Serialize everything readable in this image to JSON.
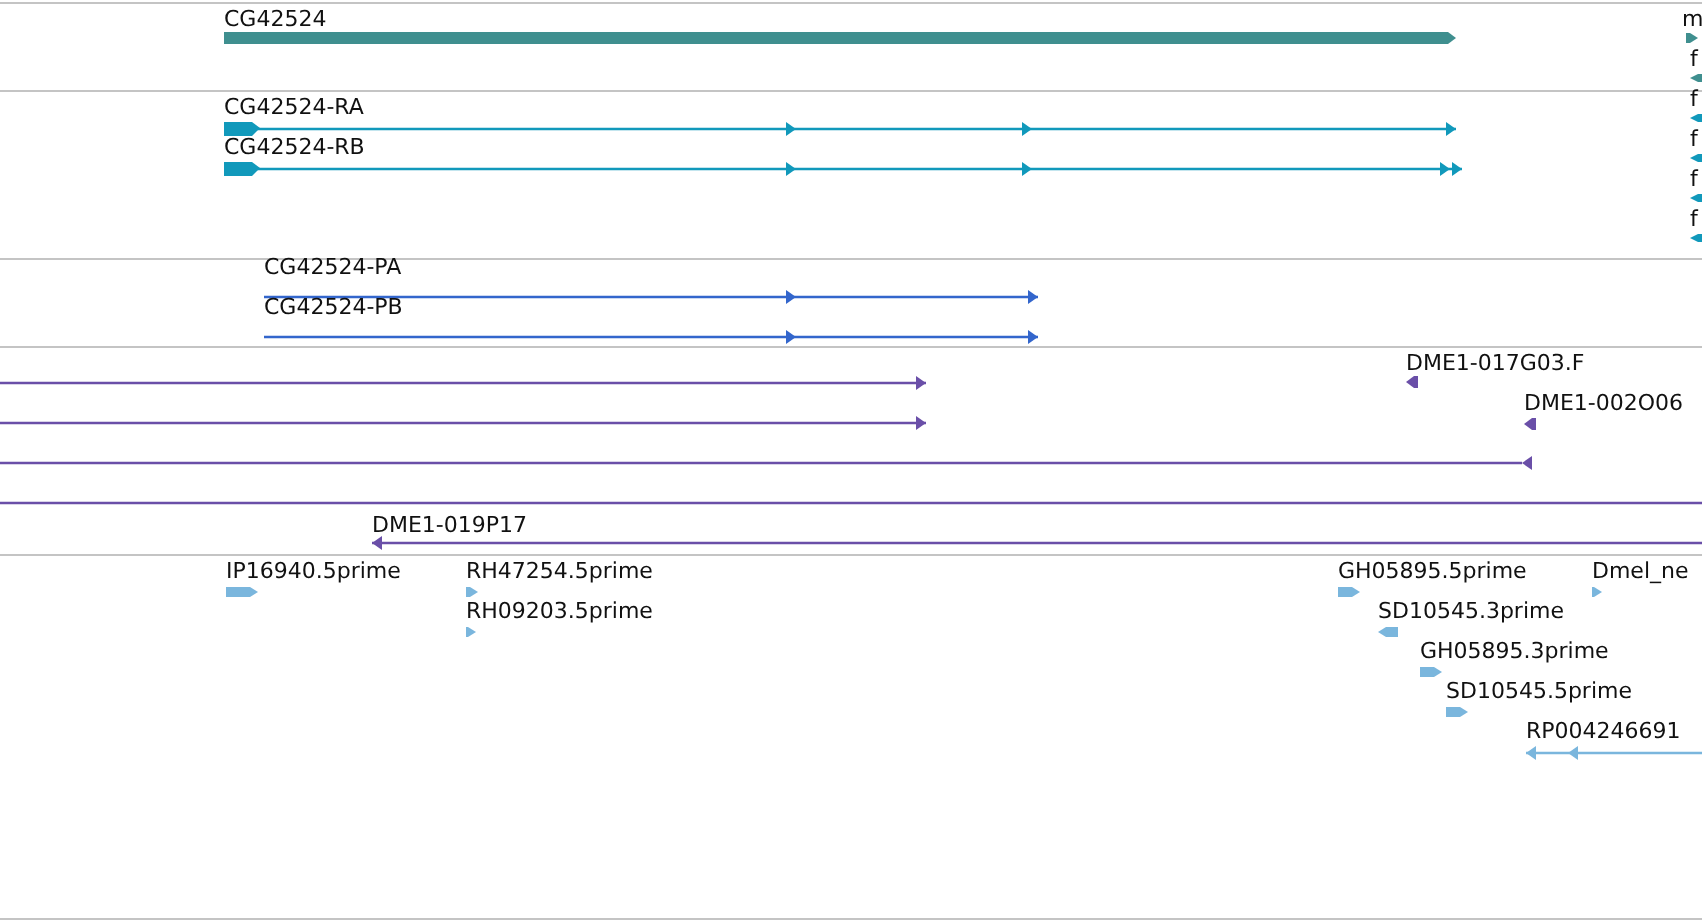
{
  "tracks": [
    {
      "kind": "gene",
      "features": [
        {
          "label": "CG42524",
          "reverse": false
        },
        {
          "label": "m",
          "reverse": false
        },
        {
          "label": "f",
          "reverse": true
        }
      ]
    },
    {
      "kind": "transcript",
      "features": [
        {
          "label": "CG42524-RA",
          "reverse": false
        },
        {
          "label": "CG42524-RB",
          "reverse": false
        },
        {
          "label": "f",
          "reverse": true
        },
        {
          "label": "f",
          "reverse": true
        },
        {
          "label": "f",
          "reverse": true
        },
        {
          "label": "f",
          "reverse": true
        }
      ]
    },
    {
      "kind": "protein",
      "features": [
        {
          "label": "CG42524-PA",
          "reverse": false
        },
        {
          "label": "CG42524-PB",
          "reverse": false
        }
      ]
    },
    {
      "kind": "clone",
      "features": [
        {
          "reverse": false
        },
        {
          "label": "DME1-017G03.F",
          "reverse": true
        },
        {
          "reverse": false
        },
        {
          "label": "DME1-002O06",
          "reverse": true
        },
        {
          "reverse": true
        },
        {
          "label": "DME1-019P17",
          "reverse": true
        }
      ]
    },
    {
      "kind": "est",
      "features": [
        {
          "label": "IP16940.5prime",
          "reverse": false
        },
        {
          "label": "RH47254.5prime",
          "reverse": false
        },
        {
          "label": "GH05895.5prime",
          "reverse": false
        },
        {
          "label": "Dmel_ne",
          "reverse": false
        },
        {
          "label": "RH09203.5prime",
          "reverse": false
        },
        {
          "label": "SD10545.3prime",
          "reverse": true
        },
        {
          "label": "GH05895.3prime",
          "reverse": false
        },
        {
          "label": "SD10545.5prime",
          "reverse": false
        },
        {
          "label": "RP004246691",
          "reverse": true
        }
      ]
    }
  ]
}
